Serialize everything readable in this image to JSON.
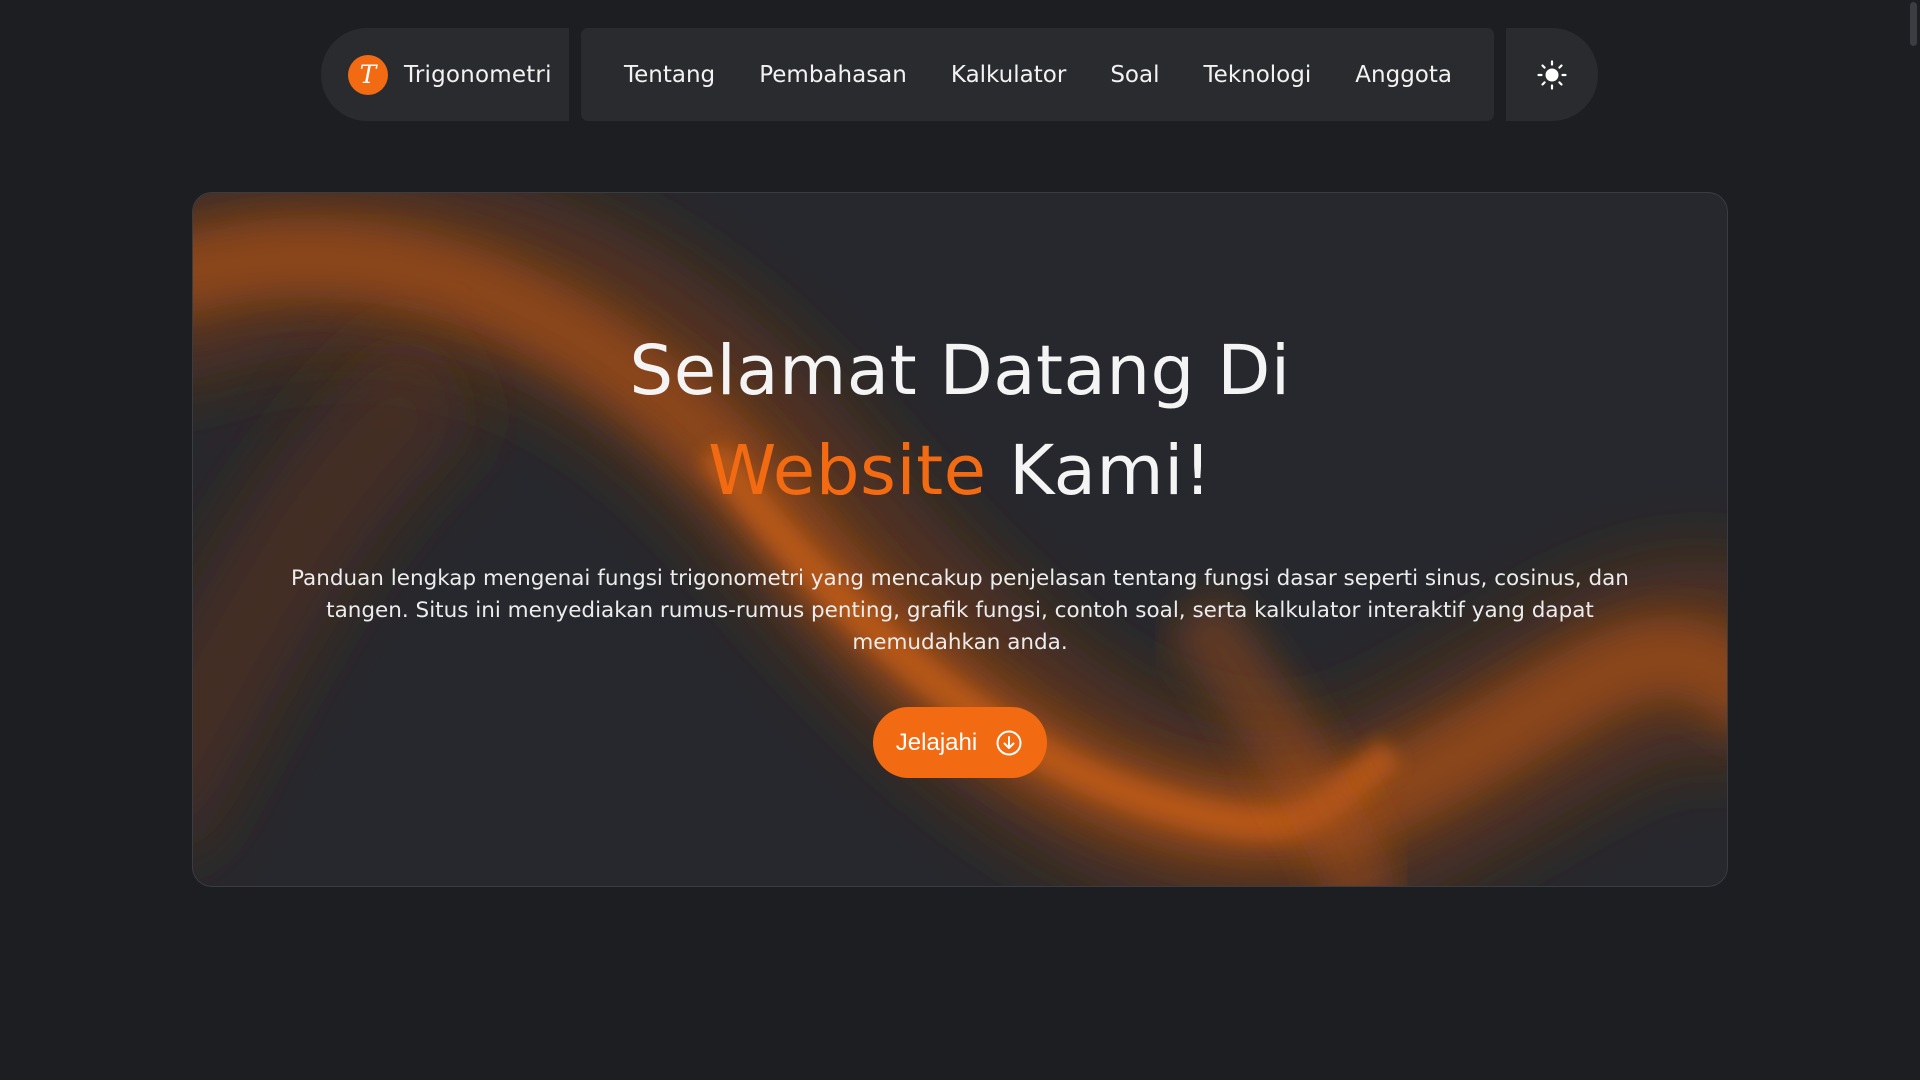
{
  "navbar": {
    "brand": {
      "logo_letter": "T",
      "name": "Trigonometri",
      "logo_color": "#f26a12"
    },
    "menu": [
      {
        "label": "Tentang"
      },
      {
        "label": "Pembahasan"
      },
      {
        "label": "Kalkulator"
      },
      {
        "label": "Soal"
      },
      {
        "label": "Teknologi"
      },
      {
        "label": "Anggota"
      }
    ],
    "theme_toggle_icon": "sun-icon"
  },
  "hero": {
    "title_line1": "Selamat Datang Di",
    "title_accent": "Website",
    "title_line2_rest": "Kami!",
    "description": "Panduan lengkap mengenai fungsi trigonometri yang mencakup penjelasan tentang fungsi dasar seperti sinus, cosinus, dan tangen. Situs ini menyediakan rumus-rumus penting, grafik fungsi, contoh soal, serta kalkulator interaktif yang dapat memudahkan anda.",
    "button_label": "Jelajahi",
    "button_icon": "arrow-down-circle-icon"
  },
  "colors": {
    "accent": "#f26a12",
    "background": "#1d1e21",
    "surface": "#2a2b2e",
    "hero_surface": "#26282d"
  }
}
